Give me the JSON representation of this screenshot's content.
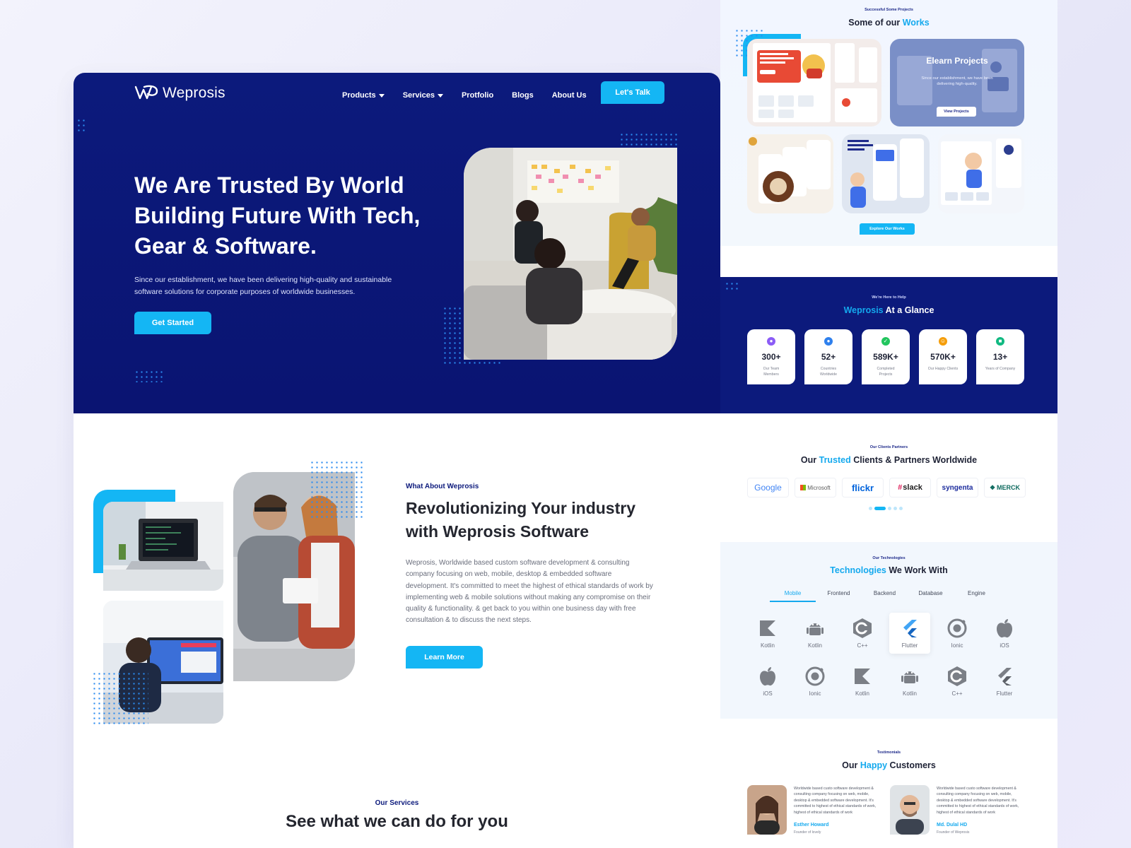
{
  "brand": {
    "name": "Weprosis"
  },
  "nav": {
    "items": [
      {
        "label": "Products",
        "dropdown": true
      },
      {
        "label": "Services",
        "dropdown": true
      },
      {
        "label": "Protfolio",
        "dropdown": false
      },
      {
        "label": "Blogs",
        "dropdown": false
      },
      {
        "label": "About Us",
        "dropdown": false
      }
    ],
    "cta": "Let's Talk"
  },
  "hero": {
    "title": "We Are Trusted By World Building Future With Tech, Gear & Software.",
    "subtitle": "Since our establishment, we have been delivering high-quality and sustainable software solutions for corporate purposes of worldwide businesses.",
    "cta": "Get Started"
  },
  "about": {
    "label": "What About Weprosis",
    "title": "Revolutionizing Your industry with Weprosis Software",
    "text": "Weprosis, Worldwide based custom software development & consulting company focusing on web, mobile, desktop & embedded software development. It's committed to meet the highest of ethical standards of work by implementing web & mobile solutions without making any compromise on their quality & functionality. & get back to you within one business day with free consultation & to discuss the next steps.",
    "cta": "Learn More"
  },
  "services": {
    "label": "Our Services",
    "title": "See what we can do for you"
  },
  "works": {
    "label": "Successful Some Projects",
    "title_prefix": "Some of our ",
    "title_accent": "Works",
    "featured_title": "Elearn Projects",
    "featured_text": "Since our establishment, we have been delivering high-quality.",
    "featured_cta": "View Projects",
    "cta": "Explore Our Works"
  },
  "glance": {
    "label": "We're Here to Help",
    "title_accent": "Weprosis",
    "title_suffix": " At a Glance",
    "stats": [
      {
        "value": "300+",
        "label": "Our Team Members",
        "icon": "team-icon",
        "color": "#8b5cf6"
      },
      {
        "value": "52+",
        "label": "Countries Worldwide",
        "icon": "globe-icon",
        "color": "#2f80ed"
      },
      {
        "value": "589K+",
        "label": "Completed Projects",
        "icon": "check-icon",
        "color": "#22c55e"
      },
      {
        "value": "570K+",
        "label": "Our Happy Clients",
        "icon": "happy-icon",
        "color": "#f59e0b"
      },
      {
        "value": "13+",
        "label": "Years of Company",
        "icon": "calendar-icon",
        "color": "#10b981"
      }
    ]
  },
  "partners": {
    "label": "Our Clients Partners",
    "title_prefix": "Our ",
    "title_accent": "Trusted",
    "title_suffix": " Clients & Partners Worldwide",
    "logos": [
      {
        "name": "Google",
        "color": "#4285f4"
      },
      {
        "name": "Microsoft",
        "color": "#5e5e5e"
      },
      {
        "name": "flickr",
        "color": "#0063dc"
      },
      {
        "name": "slack",
        "color": "#1d1c1d"
      },
      {
        "name": "syngenta",
        "color": "#1a2a9c"
      },
      {
        "name": "MERCK",
        "color": "#0f6b5f"
      }
    ]
  },
  "tech": {
    "label": "Our Technologies",
    "title_accent": "Technologies",
    "title_suffix": " We Work With",
    "tabs": [
      "Mobile",
      "Frontend",
      "Backend",
      "Database",
      "Engine"
    ],
    "active_tab": "Mobile",
    "row1": [
      {
        "name": "Kotlin",
        "icon": "kotlin-icon"
      },
      {
        "name": "Kotlin",
        "icon": "android-icon"
      },
      {
        "name": "C++",
        "icon": "cpp-icon"
      },
      {
        "name": "Flutter",
        "icon": "flutter-icon",
        "selected": true
      },
      {
        "name": "Ionic",
        "icon": "ionic-icon"
      },
      {
        "name": "iOS",
        "icon": "apple-icon"
      }
    ],
    "row2": [
      {
        "name": "iOS",
        "icon": "apple-icon"
      },
      {
        "name": "Ionic",
        "icon": "ionic-icon"
      },
      {
        "name": "Kotlin",
        "icon": "kotlin-icon"
      },
      {
        "name": "Kotlin",
        "icon": "android-icon"
      },
      {
        "name": "C++",
        "icon": "cpp-icon"
      },
      {
        "name": "Flutter",
        "icon": "flutter-icon"
      }
    ]
  },
  "testimonials": {
    "label": "Testimonials",
    "title_prefix": "Our ",
    "title_accent": "Happy",
    "title_suffix": " Customers",
    "items": [
      {
        "text": "Worldwide based custo software development & consulting company focusing on web, mobile, desktop & embedded software development. It's committed to highest of ethical standards of work, highest of ethical standards of work",
        "name": "Esther Howard",
        "role": "Founder of lovely"
      },
      {
        "text": "Worldwide based custo software development & consulting company focusing on web, mobile, desktop & embedded software development. It's committed to highest of ethical standards of work, highest of ethical standards of work",
        "name": "Md. Dulal HD",
        "role": "Founder of Weprosis"
      }
    ]
  }
}
